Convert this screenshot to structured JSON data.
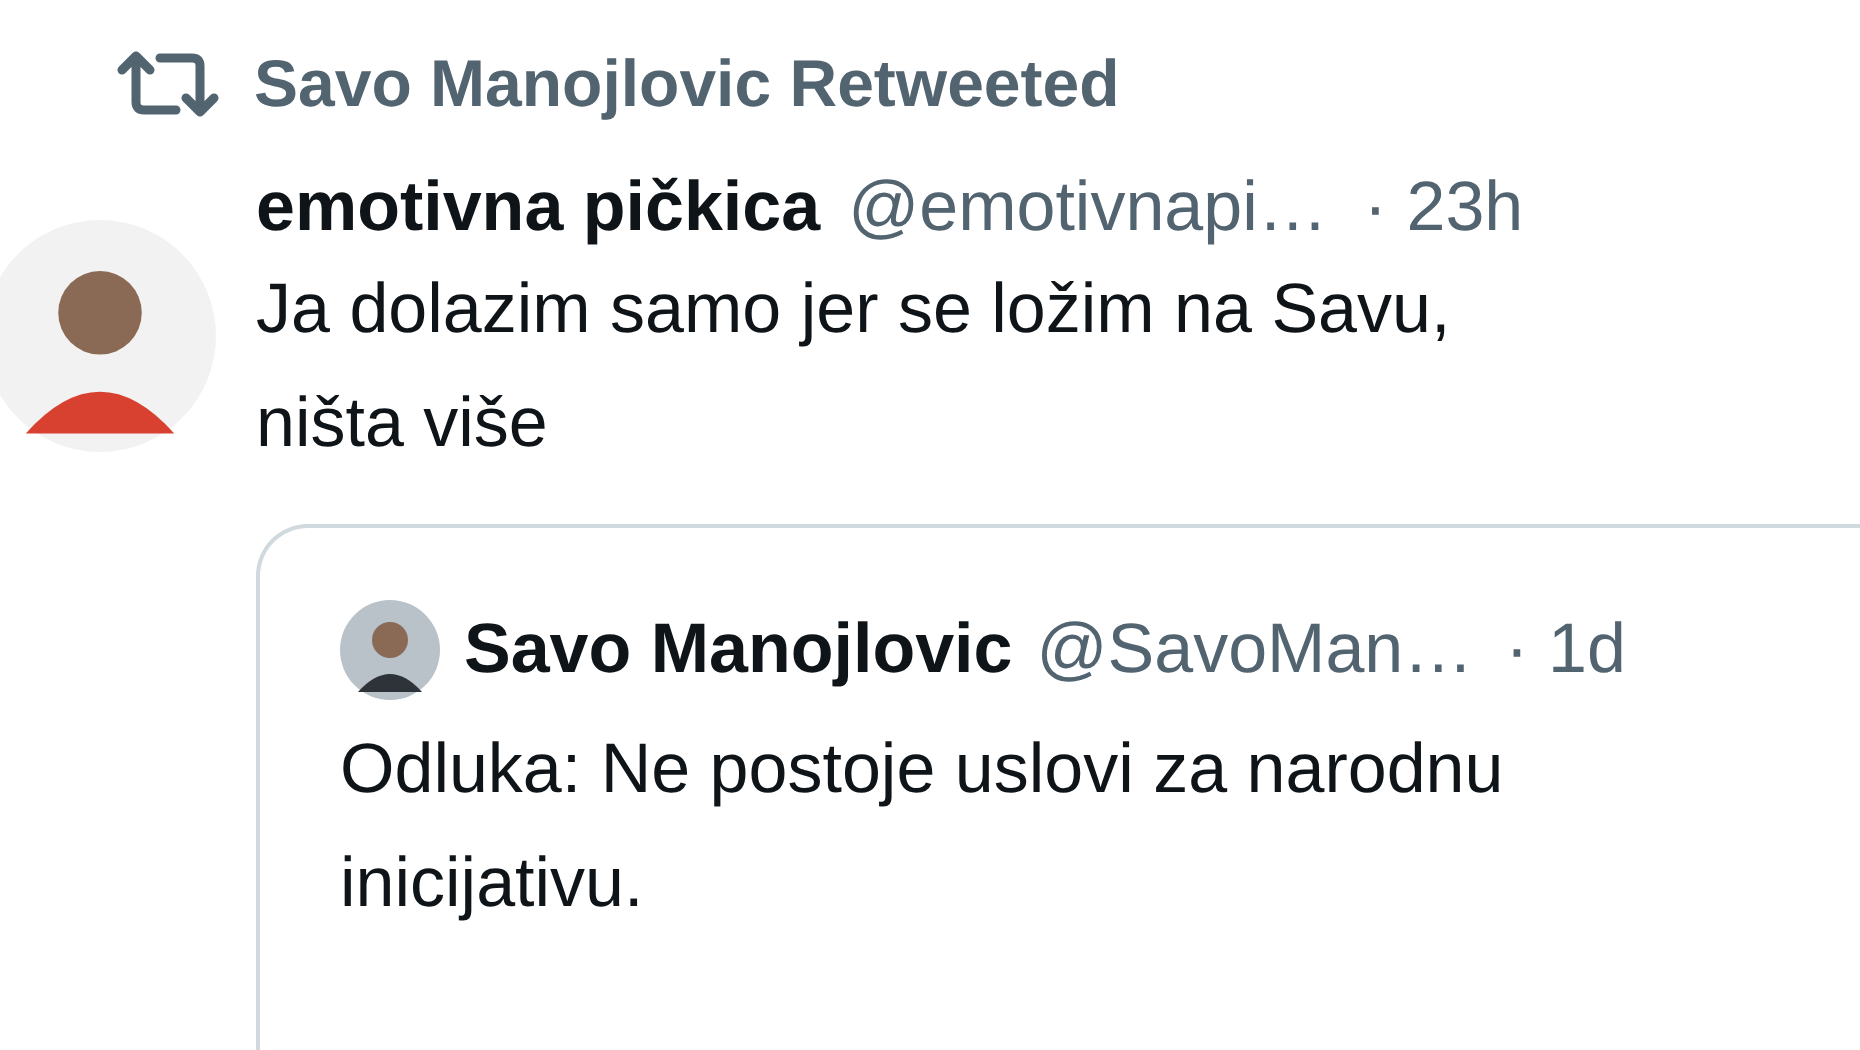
{
  "retweet": {
    "label": "Savo Manojlovic Retweeted"
  },
  "tweet": {
    "name": "emotivna pičkica",
    "handle": "@emotivnapi…",
    "time": "· 23h",
    "lines": [
      "Ja dolazim samo jer se ložim na Savu,",
      "ništa više"
    ]
  },
  "quote": {
    "name": "Savo Manojlovic",
    "handle": "@SavoMan…",
    "time": "· 1d",
    "lines": [
      "Odluka: Ne postoje uslovi za narodnu",
      "inicijativu."
    ]
  }
}
